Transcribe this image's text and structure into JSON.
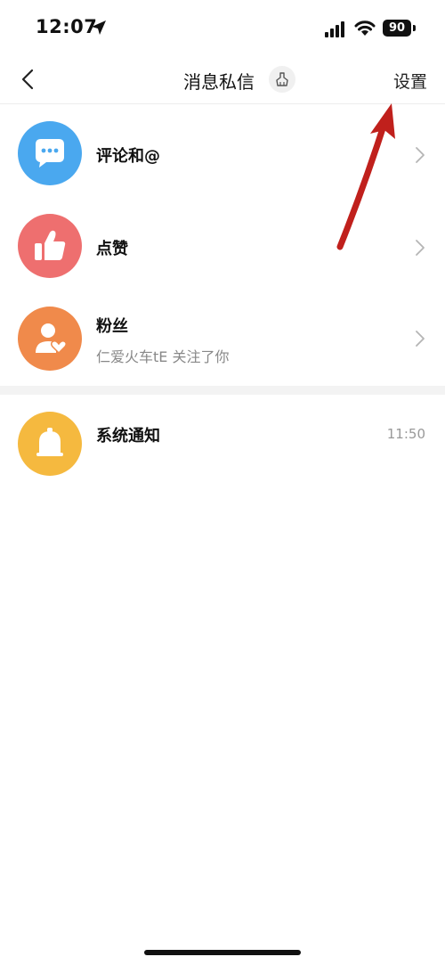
{
  "status": {
    "time": "12:07",
    "battery": "90"
  },
  "nav": {
    "title": "消息私信",
    "settings_label": "设置"
  },
  "items": [
    {
      "title": "评论和@",
      "subtitle": "",
      "time": "",
      "color": "#4aa8ef",
      "icon": "chat-bubble-icon"
    },
    {
      "title": "点赞",
      "subtitle": "",
      "time": "",
      "color": "#ee6f6f",
      "icon": "thumbs-up-icon"
    },
    {
      "title": "粉丝",
      "subtitle": "仁爱火车tE 关注了你",
      "time": "",
      "color": "#f08a4b",
      "icon": "follower-icon"
    },
    {
      "title": "系统通知",
      "subtitle": "",
      "time": "11:50",
      "color": "#f5b93f",
      "icon": "bell-icon"
    }
  ]
}
